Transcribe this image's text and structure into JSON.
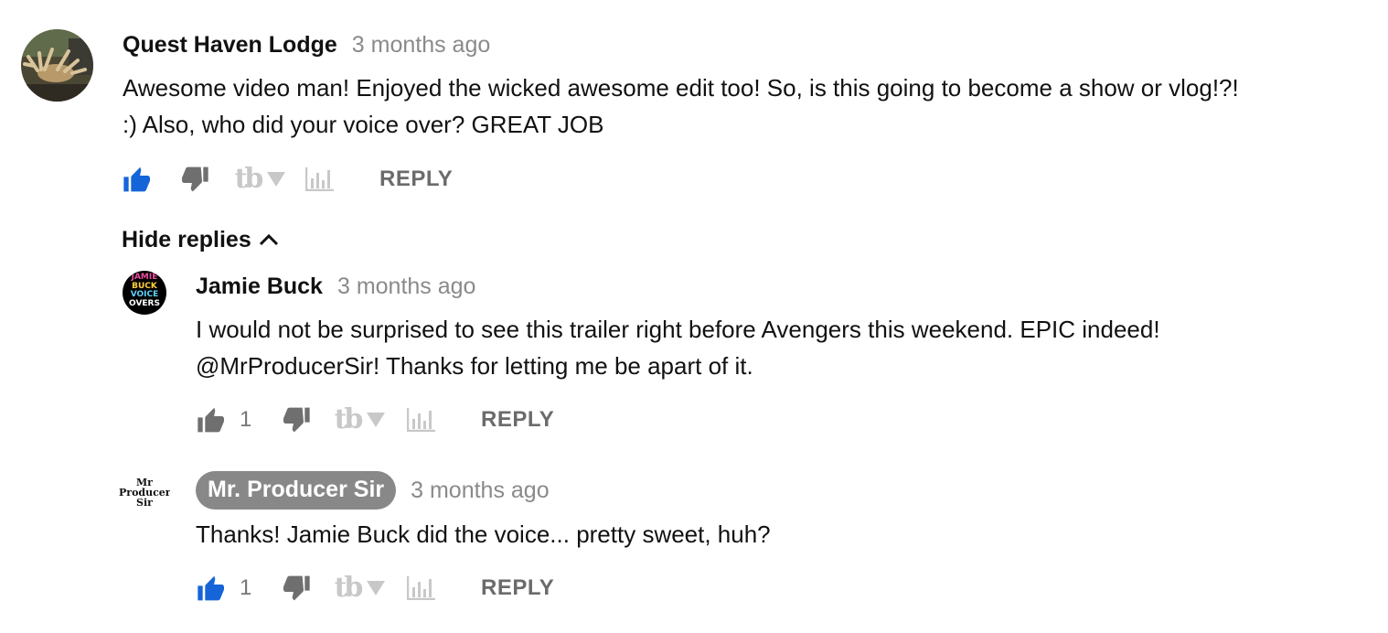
{
  "comments": [
    {
      "author": "Quest Haven Lodge",
      "time": "3 months ago",
      "lines": [
        "Awesome video man! Enjoyed the wicked awesome edit too! So, is this going to become a show or vlog!?!",
        ":) Also, who did your voice over? GREAT JOB"
      ],
      "likes": "",
      "liked": true,
      "reply_label": "REPLY"
    }
  ],
  "hide_replies_label": "Hide replies",
  "replies": [
    {
      "author": "Jamie Buck",
      "avatar_text": [
        "JAMIE",
        "BUCK",
        "VOICE",
        "OVERS"
      ],
      "time": "3 months ago",
      "lines": [
        "I would not be surprised to see this trailer right before Avengers this weekend. EPIC indeed!",
        "@MrProducerSir! Thanks for letting me be apart of it."
      ],
      "likes": "1",
      "liked": false,
      "reply_label": "REPLY"
    },
    {
      "author": "Mr. Producer Sir",
      "avatar_text": [
        "Mr",
        "Producer",
        "Sir"
      ],
      "time": "3 months ago",
      "lines": [
        "Thanks! Jamie Buck did the voice... pretty sweet, huh?"
      ],
      "likes": "1",
      "liked": true,
      "reply_label": "REPLY"
    }
  ],
  "tube_buddy_glyph": "tb",
  "colors": {
    "like_active": "#1565d8",
    "icon_inactive": "#6f6f6f",
    "owner_badge": "#888888",
    "timestamp": "#8a8a8a"
  },
  "icons": [
    "thumbs-up-icon",
    "thumbs-down-icon",
    "tube-buddy-icon",
    "dropdown-arrow-icon",
    "analytics-icon",
    "chevron-up-icon"
  ]
}
